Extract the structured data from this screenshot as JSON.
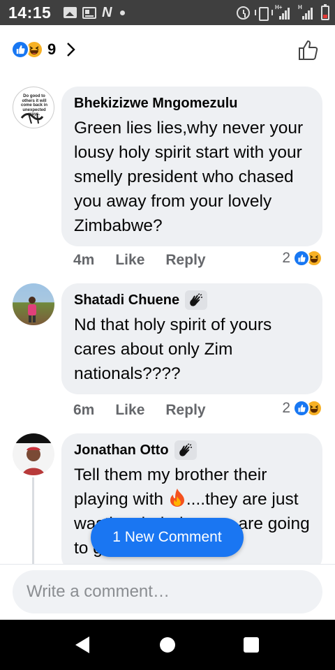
{
  "status_bar": {
    "time": "14:15",
    "left_icons": [
      "gallery-icon",
      "news-icon",
      "n-app-icon",
      "dot-icon"
    ],
    "right_icons": [
      "alarm-icon",
      "vibrate-icon",
      "signal-icon",
      "signal-icon",
      "battery-icon"
    ],
    "network_label_1": "H+",
    "network_label_2": "H",
    "battery_color": "#e53935"
  },
  "header": {
    "reaction_count": "9",
    "reaction_icons": [
      "like-icon",
      "haha-icon"
    ]
  },
  "colors": {
    "like_blue": "#1877f2",
    "haha_yellow": "#f7b125",
    "bubble_bg": "#eef0f3",
    "action_gray": "#65676b",
    "pill_blue": "#1a76f2"
  },
  "comments": [
    {
      "author": "Bhekizizwe Mngomezulu",
      "avatar_caption": "Do good to others it will come back in unexpected ways.",
      "text": "Green lies lies,why never your lousy holy spirit start with your smelly president who chased you away from your lovely Zimbabwe?",
      "time": "4m",
      "like": "Like",
      "reply": "Reply",
      "reactions": "2"
    },
    {
      "author": "Shatadi Chuene",
      "badge": "wave-hands-icon",
      "text": "Nd that holy spirit of yours cares about only Zim nationals????",
      "time": "6m",
      "like": "Like",
      "reply": "Reply",
      "reactions": "2"
    },
    {
      "author": "Jonathan Otto",
      "badge": "wave-hands-icon",
      "text_before_emoji": "Tell them my brother their playing with ",
      "emoji": "fire-emoji",
      "text_after_emoji": "....they are just wasting their time we are going to go where we"
    }
  ],
  "new_comment_pill": "1 New Comment",
  "composer": {
    "placeholder": "Write a comment…"
  },
  "nav_bar": {
    "buttons": [
      "back-icon",
      "home-icon",
      "recents-icon"
    ]
  }
}
